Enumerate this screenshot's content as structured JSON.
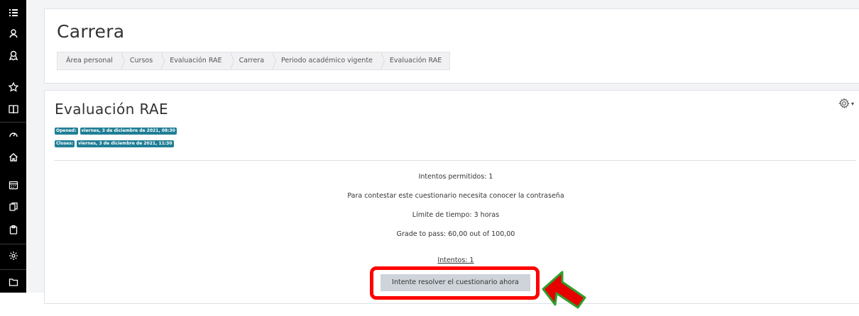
{
  "rail": {
    "icons": [
      "list-icon",
      "user-graduate-icon",
      "award-icon",
      "star-icon",
      "book-icon",
      "dashboard-icon",
      "home-icon",
      "calendar-icon",
      "files-icon",
      "clipboard-icon",
      "gear-icon",
      "folder-icon"
    ]
  },
  "header": {
    "title": "Carrera",
    "breadcrumb": [
      "Área personal",
      "Cursos",
      "Evaluación RAE",
      "Carrera",
      "Periodo académico vigente",
      "Evaluación RAE"
    ]
  },
  "quiz": {
    "title": "Evaluación RAE",
    "opened_label": "Opened:",
    "opened_value": "viernes, 3 de diciembre de 2021, 08:30",
    "closes_label": "Closes:",
    "closes_value": "viernes, 3 de diciembre de 2021, 11:30",
    "info": [
      "Intentos permitidos: 1",
      "Para contestar este cuestionario necesita conocer la contraseña",
      "Límite de tiempo: 3 horas",
      "Grade to pass: 60,00 out of 100,00"
    ],
    "attempts_link": "Intentos: 1",
    "attempt_button": "Intente resolver el cuestionario ahora"
  },
  "colors": {
    "rail": "#000000",
    "badge": "#1f7e95",
    "button": "#ced4da",
    "highlight": "#ff0000"
  }
}
